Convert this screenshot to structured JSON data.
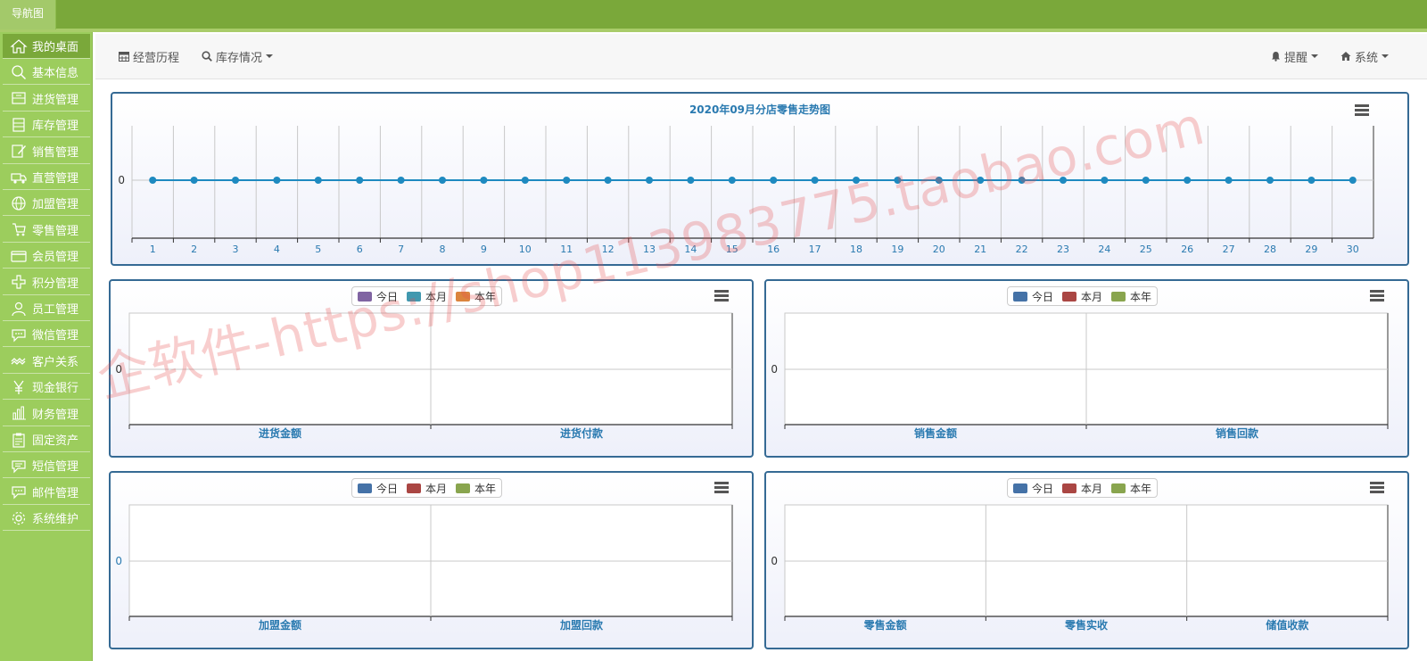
{
  "topbar": {
    "nav_tab": "导航图"
  },
  "sidebar": {
    "items": [
      {
        "label": "我的桌面",
        "icon": "home-icon",
        "active": true
      },
      {
        "label": "基本信息",
        "icon": "search-icon"
      },
      {
        "label": "进货管理",
        "icon": "inbox-icon"
      },
      {
        "label": "库存管理",
        "icon": "list-icon"
      },
      {
        "label": "销售管理",
        "icon": "edit-icon"
      },
      {
        "label": "直营管理",
        "icon": "truck-icon"
      },
      {
        "label": "加盟管理",
        "icon": "globe-icon"
      },
      {
        "label": "零售管理",
        "icon": "cart-icon"
      },
      {
        "label": "会员管理",
        "icon": "card-icon"
      },
      {
        "label": "积分管理",
        "icon": "plus-icon"
      },
      {
        "label": "员工管理",
        "icon": "user-icon"
      },
      {
        "label": "微信管理",
        "icon": "chat-icon"
      },
      {
        "label": "客户关系",
        "icon": "handshake-icon"
      },
      {
        "label": "现金银行",
        "icon": "yen-icon"
      },
      {
        "label": "财务管理",
        "icon": "bar-chart-icon"
      },
      {
        "label": "固定资产",
        "icon": "clipboard-icon"
      },
      {
        "label": "短信管理",
        "icon": "sms-icon"
      },
      {
        "label": "邮件管理",
        "icon": "mail-chat-icon"
      },
      {
        "label": "系统维护",
        "icon": "gear-icon"
      }
    ]
  },
  "header": {
    "history": "经营历程",
    "inventory": "库存情况",
    "reminder": "提醒",
    "system": "系统"
  },
  "watermark": "企软件-https://shop113983775.taobao.com",
  "colors": {
    "topbar": "#7aa83a",
    "sidebar": "#9ccd5d",
    "line": "#1e8ac0",
    "axis_text": "#2a7ab0"
  },
  "chart_data": [
    {
      "type": "line",
      "title": "2020年09月分店零售走势图",
      "categories": [
        "1",
        "2",
        "3",
        "4",
        "5",
        "6",
        "7",
        "8",
        "9",
        "10",
        "11",
        "12",
        "13",
        "14",
        "15",
        "16",
        "17",
        "18",
        "19",
        "20",
        "21",
        "22",
        "23",
        "24",
        "25",
        "26",
        "27",
        "28",
        "29",
        "30"
      ],
      "series": [
        {
          "values": [
            0,
            0,
            0,
            0,
            0,
            0,
            0,
            0,
            0,
            0,
            0,
            0,
            0,
            0,
            0,
            0,
            0,
            0,
            0,
            0,
            0,
            0,
            0,
            0,
            0,
            0,
            0,
            0,
            0,
            0
          ]
        }
      ],
      "y_ticks": [
        "0"
      ],
      "grid": true
    },
    {
      "type": "bar",
      "categories": [
        "进货金额",
        "进货付款"
      ],
      "legend": [
        {
          "name": "今日",
          "color": "#8064a2"
        },
        {
          "name": "本月",
          "color": "#4198af"
        },
        {
          "name": "本年",
          "color": "#db843d"
        }
      ],
      "series": [
        {
          "name": "今日",
          "values": [
            0,
            0
          ]
        },
        {
          "name": "本月",
          "values": [
            0,
            0
          ]
        },
        {
          "name": "本年",
          "values": [
            0,
            0
          ]
        }
      ],
      "y_ticks": [
        "0"
      ]
    },
    {
      "type": "bar",
      "categories": [
        "销售金额",
        "销售回款"
      ],
      "legend": [
        {
          "name": "今日",
          "color": "#4572a7"
        },
        {
          "name": "本月",
          "color": "#aa4643"
        },
        {
          "name": "本年",
          "color": "#89a54e"
        }
      ],
      "series": [
        {
          "name": "今日",
          "values": [
            0,
            0
          ]
        },
        {
          "name": "本月",
          "values": [
            0,
            0
          ]
        },
        {
          "name": "本年",
          "values": [
            0,
            0
          ]
        }
      ],
      "y_ticks": [
        "0"
      ]
    },
    {
      "type": "bar",
      "categories": [
        "加盟金额",
        "加盟回款"
      ],
      "legend": [
        {
          "name": "今日",
          "color": "#4572a7"
        },
        {
          "name": "本月",
          "color": "#aa4643"
        },
        {
          "name": "本年",
          "color": "#89a54e"
        }
      ],
      "series": [
        {
          "name": "今日",
          "values": [
            0,
            0
          ]
        },
        {
          "name": "本月",
          "values": [
            0,
            0
          ]
        },
        {
          "name": "本年",
          "values": [
            0,
            0
          ]
        }
      ],
      "y_ticks": [
        "0"
      ]
    },
    {
      "type": "bar",
      "categories": [
        "零售金额",
        "零售实收",
        "储值收款"
      ],
      "legend": [
        {
          "name": "今日",
          "color": "#4572a7"
        },
        {
          "name": "本月",
          "color": "#aa4643"
        },
        {
          "name": "本年",
          "color": "#89a54e"
        }
      ],
      "series": [
        {
          "name": "今日",
          "values": [
            0,
            0,
            0
          ]
        },
        {
          "name": "本月",
          "values": [
            0,
            0,
            0
          ]
        },
        {
          "name": "本年",
          "values": [
            0,
            0,
            0
          ]
        }
      ],
      "y_ticks": [
        "0"
      ]
    }
  ]
}
